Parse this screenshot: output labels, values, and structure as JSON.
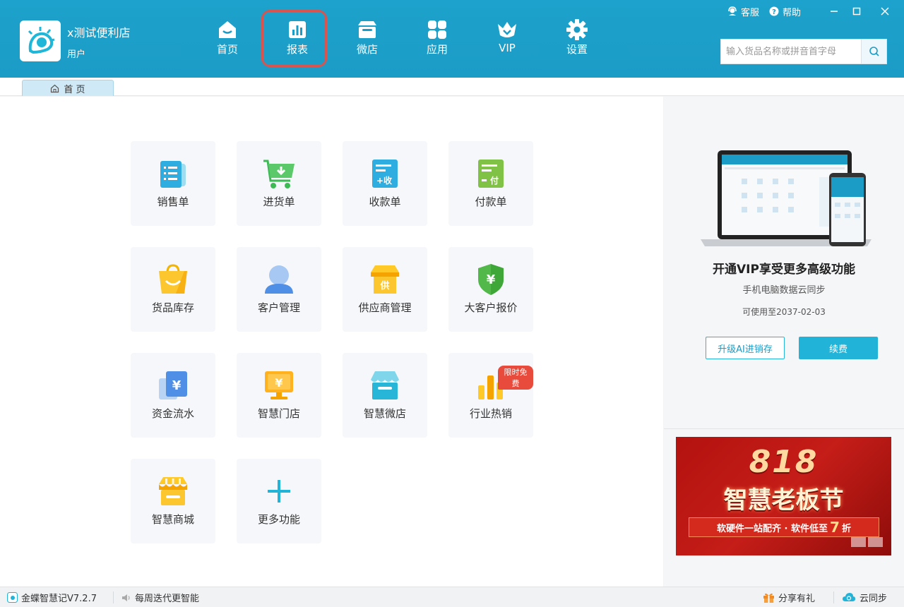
{
  "header": {
    "store_name": "x测试便利店",
    "store_role": "用户",
    "nav": [
      {
        "label": "首页",
        "icon": "home-icon"
      },
      {
        "label": "报表",
        "icon": "report-chart-icon"
      },
      {
        "label": "微店",
        "icon": "micro-shop-icon"
      },
      {
        "label": "应用",
        "icon": "apps-grid-icon"
      },
      {
        "label": "VIP",
        "icon": "vip-crown-icon"
      },
      {
        "label": "设置",
        "icon": "gear-icon"
      }
    ],
    "top_links": {
      "service": "客服",
      "help": "帮助"
    },
    "search_placeholder": "输入货品名称或拼音首字母",
    "search_value": ""
  },
  "tabs": [
    {
      "label": "首 页",
      "icon": "home-outline-icon"
    }
  ],
  "tiles": [
    {
      "label": "销售单",
      "icon": "sales-order-icon"
    },
    {
      "label": "进货单",
      "icon": "purchase-cart-icon"
    },
    {
      "label": "收款单",
      "icon": "receipt-icon"
    },
    {
      "label": "付款单",
      "icon": "payment-icon"
    },
    {
      "label": "货品库存",
      "icon": "shopping-bag-icon"
    },
    {
      "label": "客户管理",
      "icon": "customer-icon"
    },
    {
      "label": "供应商管理",
      "icon": "supplier-store-icon"
    },
    {
      "label": "大客户报价",
      "icon": "shield-yen-icon"
    },
    {
      "label": "资金流水",
      "icon": "cash-flow-icon"
    },
    {
      "label": "智慧门店",
      "icon": "smart-store-monitor-icon"
    },
    {
      "label": "智慧微店",
      "icon": "smart-micro-shop-icon"
    },
    {
      "label": "行业热销",
      "icon": "hot-sales-bars-icon",
      "badge": "限时免费"
    },
    {
      "label": "智慧商城",
      "icon": "smart-mall-icon"
    },
    {
      "label": "更多功能",
      "icon": "plus-icon"
    }
  ],
  "vip": {
    "title": "开通VIP享受更多高级功能",
    "subtitle": "手机电脑数据云同步",
    "expiry": "可使用至2037-02-03",
    "upgrade_button": "升级AI进销存",
    "renew_button": "续费"
  },
  "banner": {
    "headline_number": "818",
    "headline": "智慧老板节",
    "ribbon_prefix": "软硬件一站配齐 · 软件低至",
    "ribbon_number": "7",
    "ribbon_suffix": "折"
  },
  "status": {
    "version": "金蝶智慧记V7.2.7",
    "notice": "每周迭代更智能",
    "share": "分享有礼",
    "sync": "云同步"
  },
  "colors": {
    "header": "#1b9cc6",
    "accent": "#22b3d8",
    "highlight_border": "#d9534f",
    "badge": "#e84b3c"
  }
}
